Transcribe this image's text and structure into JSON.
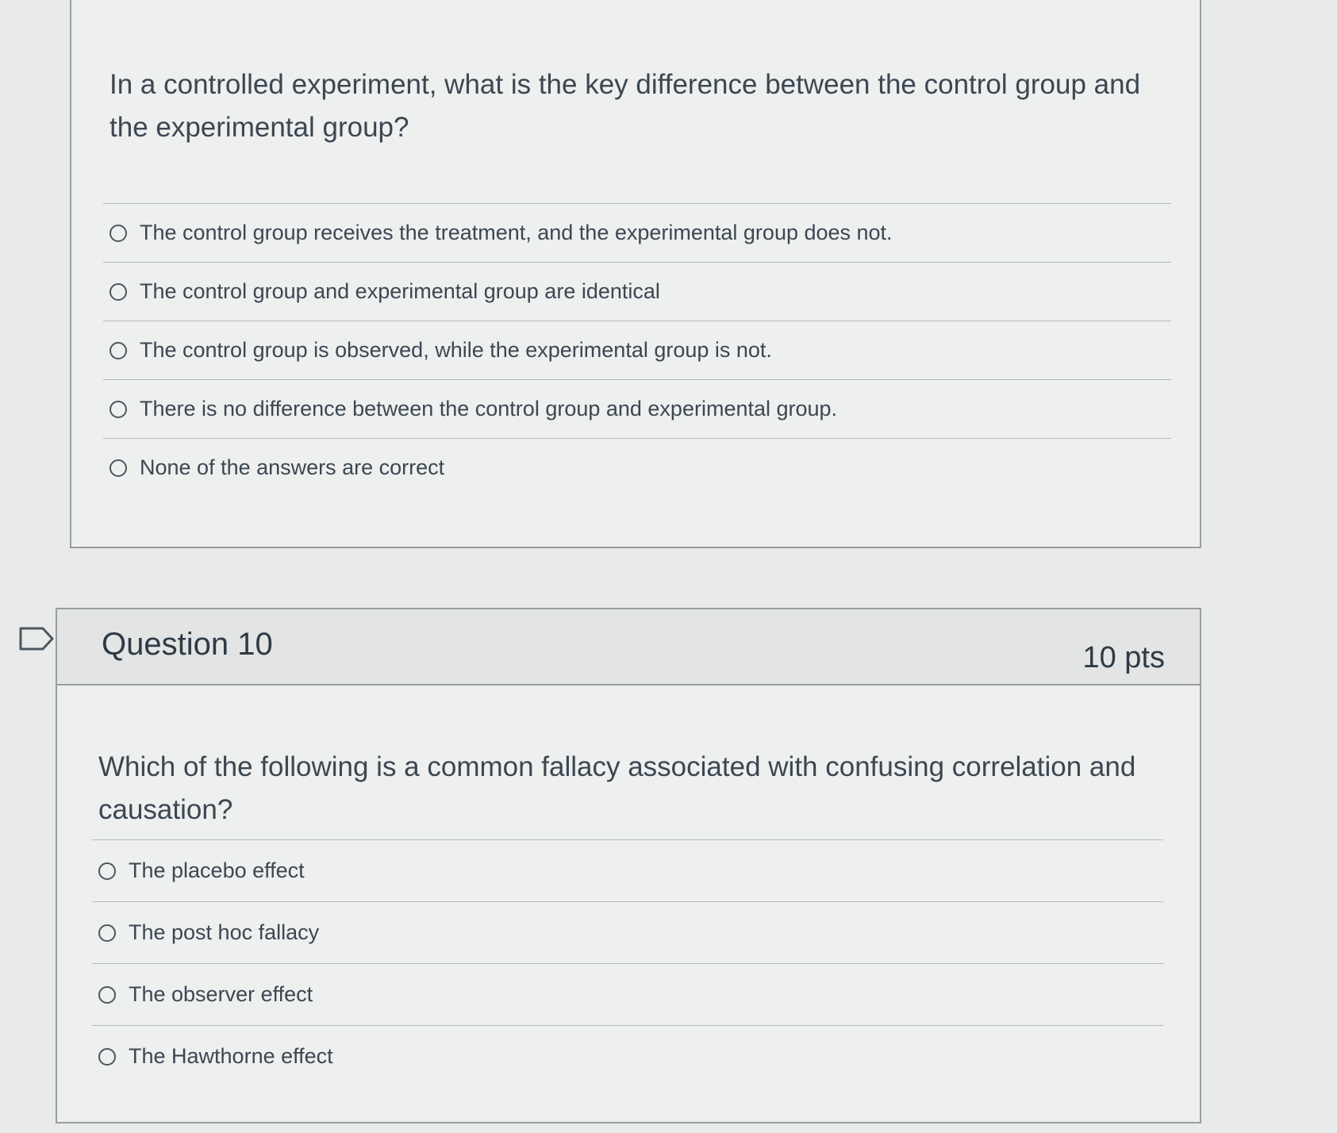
{
  "question_9": {
    "text": "In a controlled experiment, what is the key difference between the control group and the experimental group?",
    "answers": [
      {
        "label": "The control group receives the treatment, and the experimental group does not.",
        "selected": false
      },
      {
        "label": "The control group and experimental group are identical",
        "selected": false
      },
      {
        "label": "The control group is observed, while the experimental group is not.",
        "selected": false
      },
      {
        "label": "There is no difference between the control group and experimental group.",
        "selected": false
      },
      {
        "label": "None of the answers are correct",
        "selected": false
      }
    ]
  },
  "question_10": {
    "title": "Question 10",
    "points": "10 pts",
    "flag_icon": "flag-question-icon",
    "text": "Which of the following is a common fallacy associated with confusing correlation and causation?",
    "answers": [
      {
        "label": "The placebo effect",
        "selected": false
      },
      {
        "label": "The post hoc fallacy",
        "selected": false
      },
      {
        "label": "The observer effect",
        "selected": false
      },
      {
        "label": "The Hawthorne effect",
        "selected": false
      }
    ]
  },
  "colors": {
    "background": "#e9eaea",
    "card": "#eeefef",
    "header": "#e3e4e4",
    "border": "#9a9d9f",
    "text": "#3b4751"
  }
}
